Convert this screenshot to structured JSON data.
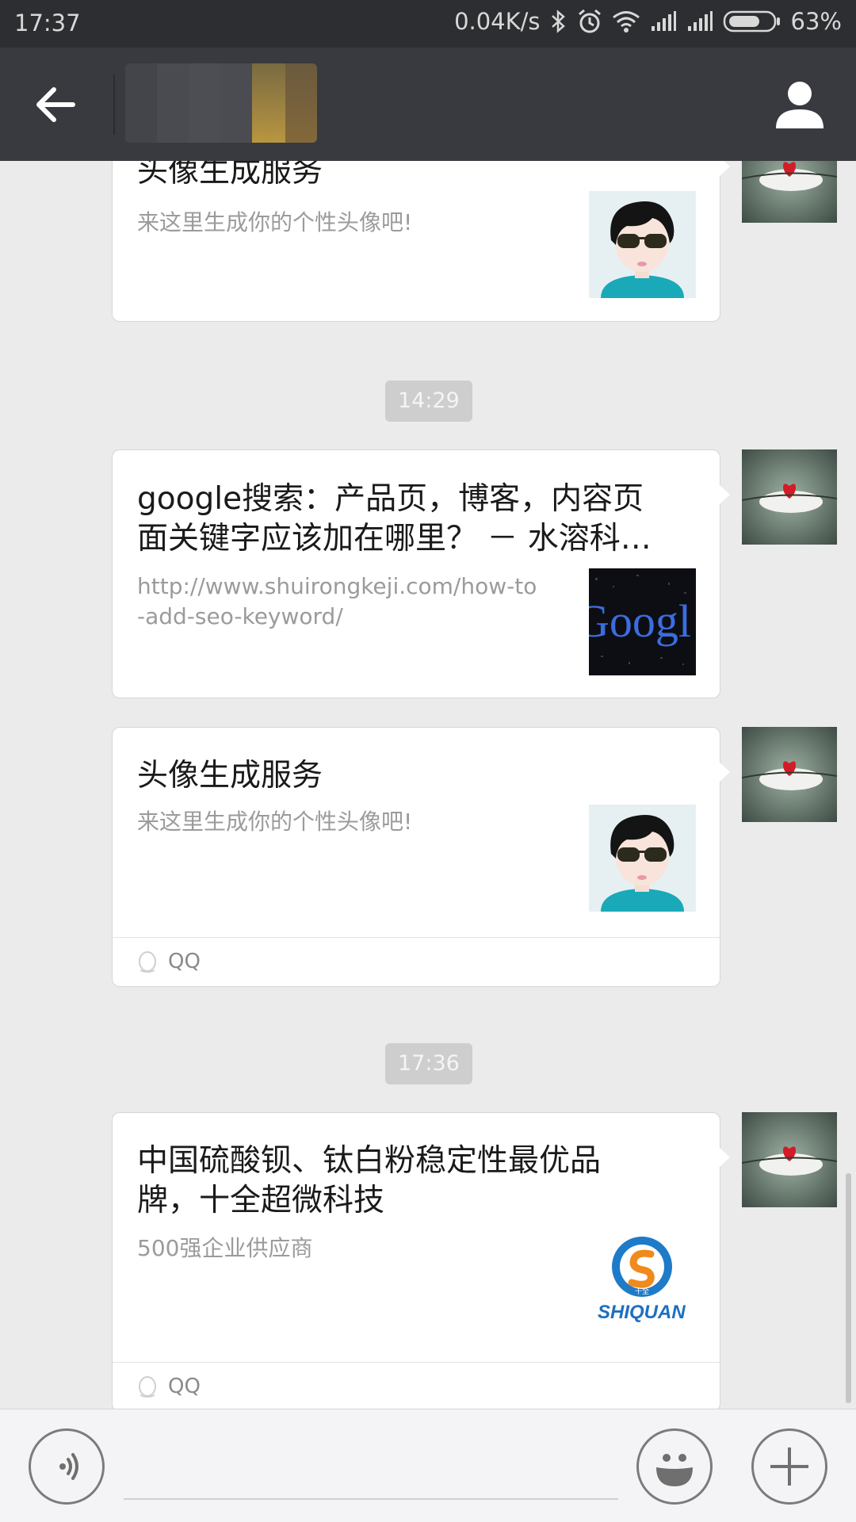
{
  "status_bar": {
    "time": "17:37",
    "speed": "0.04K/s",
    "battery": "63%",
    "icons": [
      "bluetooth-icon",
      "alarm-icon",
      "wifi-icon",
      "signal-icon",
      "signal-icon",
      "battery-icon"
    ]
  },
  "header": {
    "back_icon": "back-arrow-icon",
    "title": "",
    "profile_icon": "person-icon"
  },
  "messages": [
    {
      "title": "头像生成服务",
      "desc": "来这里生成你的个性头像吧!",
      "thumb": "cartoon-avatar-thumb"
    },
    {
      "timestamp": "14:29"
    },
    {
      "title_line1": "google搜索：产品页，博客，内容页",
      "title_line2": "面关键字应该加在哪里？ － 水溶科…",
      "desc_line1": "http://www.shuirongkeji.com/how-to",
      "desc_line2": "-add-seo-keyword/",
      "thumb_text": "Googl"
    },
    {
      "title": "头像生成服务",
      "desc": "来这里生成你的个性头像吧!",
      "source": "QQ"
    },
    {
      "timestamp": "17:36"
    },
    {
      "title_line1": "中国硫酸钡、钛白粉稳定性最优品",
      "title_line2": "牌，十全超微科技",
      "desc": "500强企业供应商",
      "logo_text": "SHIQUAN",
      "logo_small": "十全",
      "source": "QQ"
    }
  ],
  "input_bar": {
    "voice_icon": "voice-icon",
    "emoji_icon": "emoji-icon",
    "plus_icon": "plus-icon",
    "placeholder": ""
  },
  "colors": {
    "status_bar": "#2d2e31",
    "header": "#393a3f",
    "chat_bg": "#ebebeb",
    "timestamp_bg": "#cecece"
  }
}
